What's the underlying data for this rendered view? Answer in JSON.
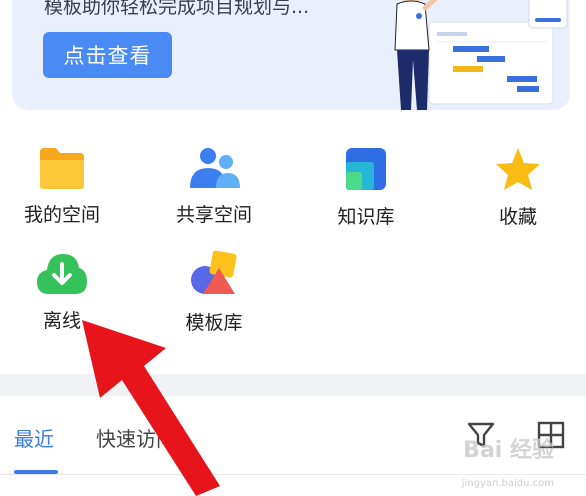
{
  "banner": {
    "text": "模板助你轻松完成项目规划与...",
    "button_label": "点击查看"
  },
  "apps": [
    {
      "label": "我的空间",
      "icon": "folder-icon"
    },
    {
      "label": "共享空间",
      "icon": "people-icon"
    },
    {
      "label": "知识库",
      "icon": "book-icon"
    },
    {
      "label": "收藏",
      "icon": "star-icon"
    },
    {
      "label": "离线",
      "icon": "cloud-download-icon"
    },
    {
      "label": "模板库",
      "icon": "shapes-icon"
    }
  ],
  "tabs": [
    {
      "label": "最近",
      "active": true
    },
    {
      "label": "快速访问",
      "active": false
    }
  ],
  "toolbar": {
    "filter_icon": "filter-icon",
    "grid_icon": "grid-view-icon"
  },
  "watermark": {
    "text": "Bai 经验",
    "sub": "jingyan.baidu.com"
  },
  "colors": {
    "accent": "#3a7be8",
    "button": "#4a8af4",
    "banner_bg": "#eaf0fb",
    "arrow": "#e8141c"
  }
}
